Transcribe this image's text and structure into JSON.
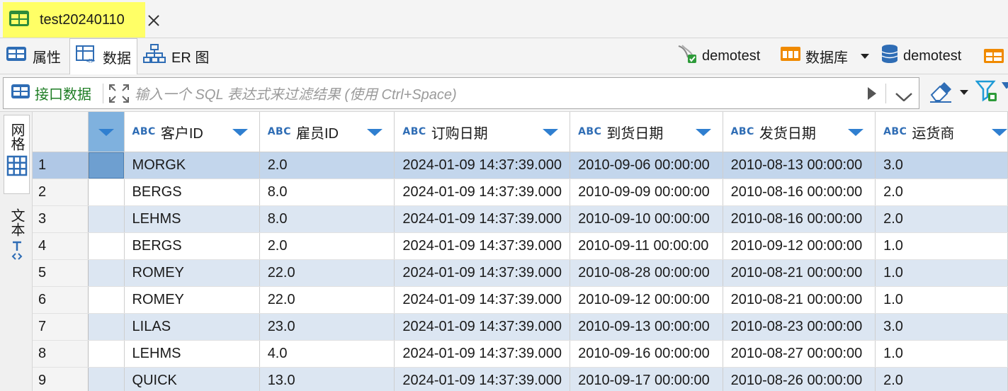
{
  "editor_tab": {
    "title": "test20240110"
  },
  "view_tabs": [
    {
      "label": "属性"
    },
    {
      "label": "数据"
    },
    {
      "label": "ER 图"
    }
  ],
  "connection": {
    "datasource": "demotest",
    "type_label": "数据库",
    "database": "demotest"
  },
  "filter": {
    "api_label": "接口数据",
    "placeholder": "输入一个 SQL 表达式来过滤结果 (使用 Ctrl+Space)"
  },
  "side_tabs": [
    {
      "label": "网格"
    },
    {
      "label": "文本"
    }
  ],
  "grid": {
    "type_badge": "ABC",
    "columns": [
      "客户ID",
      "雇员ID",
      "订购日期",
      "到货日期",
      "发货日期",
      "运货商"
    ],
    "rows": [
      {
        "num": "1",
        "cells": [
          "MORGK",
          "2.0",
          "2024-01-09 14:37:39.000",
          "2010-09-06 00:00:00",
          "2010-08-13 00:00:00",
          "3.0"
        ]
      },
      {
        "num": "2",
        "cells": [
          "BERGS",
          "8.0",
          "2024-01-09 14:37:39.000",
          "2010-09-09 00:00:00",
          "2010-08-16 00:00:00",
          "2.0"
        ]
      },
      {
        "num": "3",
        "cells": [
          "LEHMS",
          "8.0",
          "2024-01-09 14:37:39.000",
          "2010-09-10 00:00:00",
          "2010-08-16 00:00:00",
          "2.0"
        ]
      },
      {
        "num": "4",
        "cells": [
          "BERGS",
          "2.0",
          "2024-01-09 14:37:39.000",
          "2010-09-11 00:00:00",
          "2010-09-12 00:00:00",
          "1.0"
        ]
      },
      {
        "num": "5",
        "cells": [
          "ROMEY",
          "22.0",
          "2024-01-09 14:37:39.000",
          "2010-08-28 00:00:00",
          "2010-08-21 00:00:00",
          "1.0"
        ]
      },
      {
        "num": "6",
        "cells": [
          "ROMEY",
          "22.0",
          "2024-01-09 14:37:39.000",
          "2010-09-12 00:00:00",
          "2010-08-21 00:00:00",
          "1.0"
        ]
      },
      {
        "num": "7",
        "cells": [
          "LILAS",
          "23.0",
          "2024-01-09 14:37:39.000",
          "2010-09-13 00:00:00",
          "2010-08-23 00:00:00",
          "3.0"
        ]
      },
      {
        "num": "8",
        "cells": [
          "LEHMS",
          "4.0",
          "2024-01-09 14:37:39.000",
          "2010-09-16 00:00:00",
          "2010-08-27 00:00:00",
          "1.0"
        ]
      },
      {
        "num": "9",
        "cells": [
          "QUICK",
          "13.0",
          "2024-01-09 14:37:39.000",
          "2010-09-17 00:00:00",
          "2010-08-26 00:00:00",
          "2.0"
        ]
      }
    ]
  },
  "colors": {
    "active_tab_highlight": "#ffff66",
    "row_alt": "#dce6f2",
    "row_selected": "#c3d6ec",
    "type_badge": "#2f6db5",
    "sort_arrow": "#2f7fd0",
    "api_label": "#1e7d24"
  }
}
